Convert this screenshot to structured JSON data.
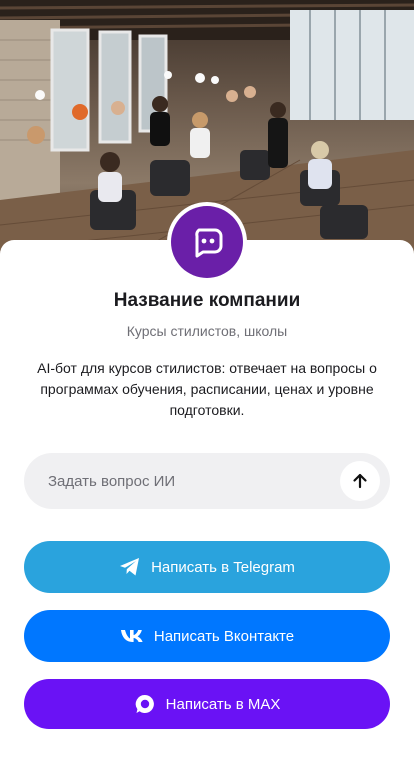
{
  "company": {
    "name": "Название компании",
    "category": "Курсы стилистов, школы",
    "description": "AI-бот для курсов стилистов: отвечает на вопросы о программах обучения, расписании, ценах и уровне подготовки."
  },
  "ask": {
    "placeholder": "Задать вопрос ИИ"
  },
  "buttons": {
    "telegram_label": "Написать в Telegram",
    "vk_label": "Написать Вконтакте",
    "max_label": "Написать в MAX"
  },
  "colors": {
    "avatar": "#6a1fa8",
    "telegram": "#2aa3dd",
    "vk": "#0077ff",
    "max": "#6a12f5"
  },
  "icons": {
    "avatar": "chat-bubble-icon",
    "send": "arrow-up-icon",
    "telegram": "telegram-icon",
    "vk": "vk-icon",
    "max": "max-icon"
  }
}
